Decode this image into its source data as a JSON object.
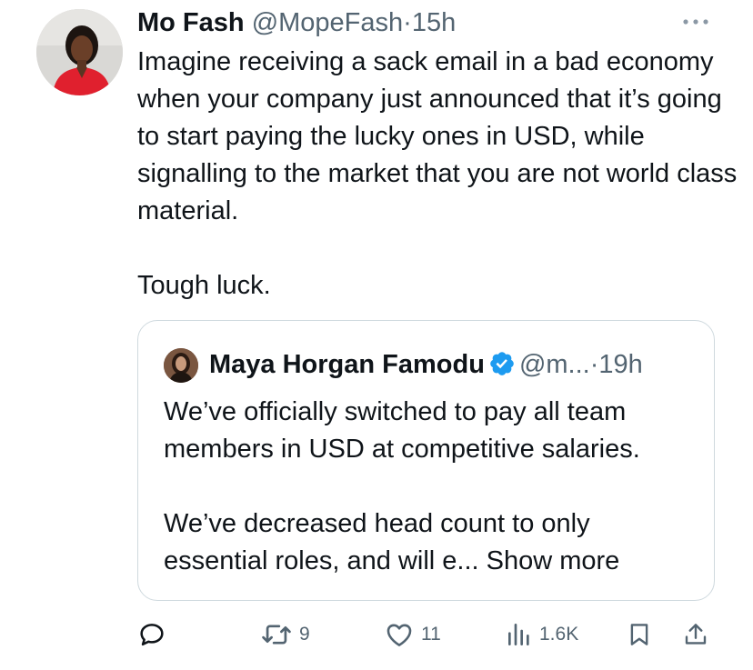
{
  "tweet": {
    "author_name": "Mo Fash",
    "author_handle": "@MopeFash",
    "separator": "·",
    "time": "15h",
    "paragraphs": [
      "Imagine receiving a sack email in a bad economy when your company just announced that it’s going to start paying the lucky ones in USD, while signalling to the market that you are not world class material.",
      "Tough luck."
    ]
  },
  "quoted": {
    "author_name": "Maya Horgan Famodu",
    "author_handle": "@m...",
    "separator": "·",
    "time": "19h",
    "paragraphs": [
      "We’ve officially switched to pay all team members in USD at competitive salaries.",
      "We’ve decreased head count to only essential roles, and will e..."
    ],
    "show_more": "Show more"
  },
  "actions": {
    "replies": "",
    "reposts": "9",
    "likes": "11",
    "views": "1.6K"
  },
  "colors": {
    "text": "#0f1419",
    "muted": "#536471",
    "border": "#cfd9de",
    "verified": "#1d9bf0"
  },
  "icons": [
    "more-icon",
    "verified-badge-icon",
    "reply-icon",
    "repost-icon",
    "like-icon",
    "views-icon",
    "bookmark-icon",
    "share-icon"
  ]
}
